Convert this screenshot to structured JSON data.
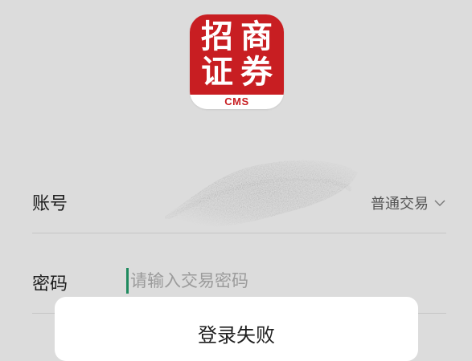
{
  "logo": {
    "chars": [
      "招",
      "商",
      "证",
      "券"
    ],
    "tag": "CMS",
    "brand_color": "#c81e22"
  },
  "form": {
    "account_label": "账号",
    "account_type": "普通交易",
    "password_label": "密码",
    "password_placeholder": "请输入交易密码"
  },
  "icons": {
    "account_type_dropdown": "chevron-down-icon"
  },
  "dialog": {
    "title": "登录失败"
  },
  "colors": {
    "caret": "#1f8a5e",
    "overlay_background": "#dcdcdc"
  }
}
